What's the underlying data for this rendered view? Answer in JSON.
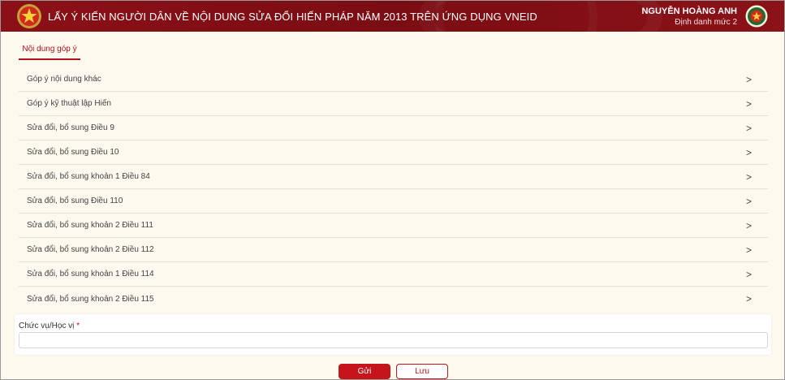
{
  "header": {
    "title": "LẤY Ý KIẾN NGƯỜI DÂN VỀ NỘI DUNG SỬA ĐỔI HIẾN PHÁP NĂM 2013 TRÊN ỨNG DỤNG VNEID",
    "user_name": "NGUYỄN HOÀNG ANH",
    "user_level": "Định danh mức 2",
    "emblem_icon": "national-emblem-icon",
    "avatar_icon": "police-badge-icon"
  },
  "tab": {
    "label": "Nội dung góp ý"
  },
  "items": [
    {
      "label": "Góp ý nội dung khác"
    },
    {
      "label": "Góp ý kỹ thuật lập Hiến"
    },
    {
      "label": "Sửa đổi, bổ sung Điều 9"
    },
    {
      "label": "Sửa đổi, bổ sung Điều 10"
    },
    {
      "label": "Sửa đổi, bổ sung khoản 1 Điều 84"
    },
    {
      "label": "Sửa đổi, bổ sung Điều 110"
    },
    {
      "label": "Sửa đổi, bổ sung khoản 2 Điều 111"
    },
    {
      "label": "Sửa đổi, bổ sung khoản 2 Điều 112"
    },
    {
      "label": "Sửa đổi, bổ sung khoản 1 Điều 114"
    },
    {
      "label": "Sửa đổi, bổ sung khoản 2 Điều 115"
    }
  ],
  "chevron": ">",
  "form": {
    "position_label": "Chức vụ/Học vị",
    "required_mark": "*",
    "position_value": ""
  },
  "buttons": {
    "send": "Gửi",
    "save": "Lưu"
  },
  "colors": {
    "header_bg": "#7a0d13",
    "accent": "#c4141c",
    "page_bg": "#fdf9ef"
  }
}
